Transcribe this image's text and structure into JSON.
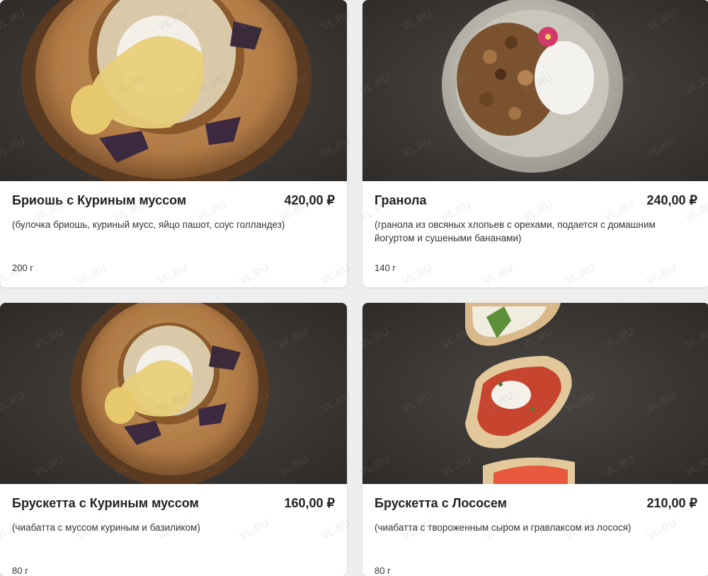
{
  "currency_symbol": "₽",
  "watermark_text": "VL.RU",
  "menu_items": [
    {
      "name": "Бриошь с Куриным муссом",
      "price": "420,00 ₽",
      "description": "(булочка бриошь, куриный мусс, яйцо пашот, соус голландез)",
      "weight": "200 г",
      "photo": "brioche-chicken-mousse-photo"
    },
    {
      "name": "Гранола",
      "price": "240,00 ₽",
      "description": "(гранола из овсяных хлопьев с орехами, подается с домашним йогуртом и сушеными бананами)",
      "weight": "140 г",
      "photo": "granola-bowl-photo"
    },
    {
      "name": "Брускетта с Куриным муссом",
      "price": "160,00 ₽",
      "description": "(чиабатта с муссом куриным и базиликом)",
      "weight": "80 г",
      "photo": "bruschetta-chicken-photo"
    },
    {
      "name": "Брускетта с Лососем",
      "price": "210,00 ₽",
      "description": "(чиабатта с твороженным сыром и гравлаксом из лосося)",
      "weight": "80 г",
      "photo": "bruschetta-salmon-photo"
    }
  ],
  "colors": {
    "page_background": "#eeeeef",
    "card_background": "#ffffff",
    "text_primary": "#222222",
    "photo_background": "#3b3836"
  }
}
